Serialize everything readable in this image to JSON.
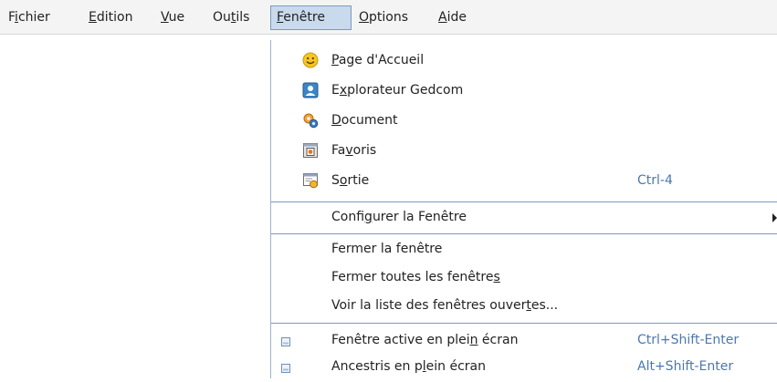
{
  "menubar": {
    "items": [
      {
        "pre": "F",
        "acc": "i",
        "post": "chier"
      },
      {
        "pre": "",
        "acc": "E",
        "post": "dition"
      },
      {
        "pre": "",
        "acc": "V",
        "post": "ue"
      },
      {
        "pre": "Ou",
        "acc": "t",
        "post": "ils"
      },
      {
        "pre": "",
        "acc": "F",
        "post": "enêtre"
      },
      {
        "pre": "",
        "acc": "O",
        "post": "ptions"
      },
      {
        "pre": "",
        "acc": "A",
        "post": "ide"
      }
    ]
  },
  "dropdown": {
    "items": [
      {
        "pre": "",
        "acc": "P",
        "post": "age d'Accueil",
        "icon": "smiley-icon"
      },
      {
        "pre": "E",
        "acc": "x",
        "post": "plorateur Gedcom",
        "icon": "person-card-icon"
      },
      {
        "pre": "",
        "acc": "D",
        "post": "ocument",
        "icon": "gears-icon"
      },
      {
        "pre": "Fa",
        "acc": "v",
        "post": "oris",
        "icon": "bookmark-icon"
      },
      {
        "pre": "S",
        "acc": "o",
        "post": "rtie",
        "icon": "output-window-icon",
        "shortcut": "Ctrl-4"
      },
      {
        "pre": "Confi",
        "acc": "g",
        "post": "urer la Fenêtre"
      },
      {
        "pre": "Fermer la fenêtre",
        "acc": "",
        "post": ""
      },
      {
        "pre": "Fermer toutes les fenêtre",
        "acc": "s",
        "post": ""
      },
      {
        "pre": "Voir la liste des fenêtres ouver",
        "acc": "t",
        "post": "es..."
      },
      {
        "pre": "Fenêtre active en plei",
        "acc": "n",
        "post": " écran",
        "shortcut": "Ctrl+Shift-Enter"
      },
      {
        "pre": "Ancestris en p",
        "acc": "l",
        "post": "ein écran",
        "shortcut": "Alt+Shift-Enter"
      }
    ]
  },
  "colors": {
    "menubar_bg": "#f4f4f4",
    "open_menu_bg": "#c9daed",
    "separator": "#7a9ac2",
    "shortcut_text": "#4a78b0"
  }
}
